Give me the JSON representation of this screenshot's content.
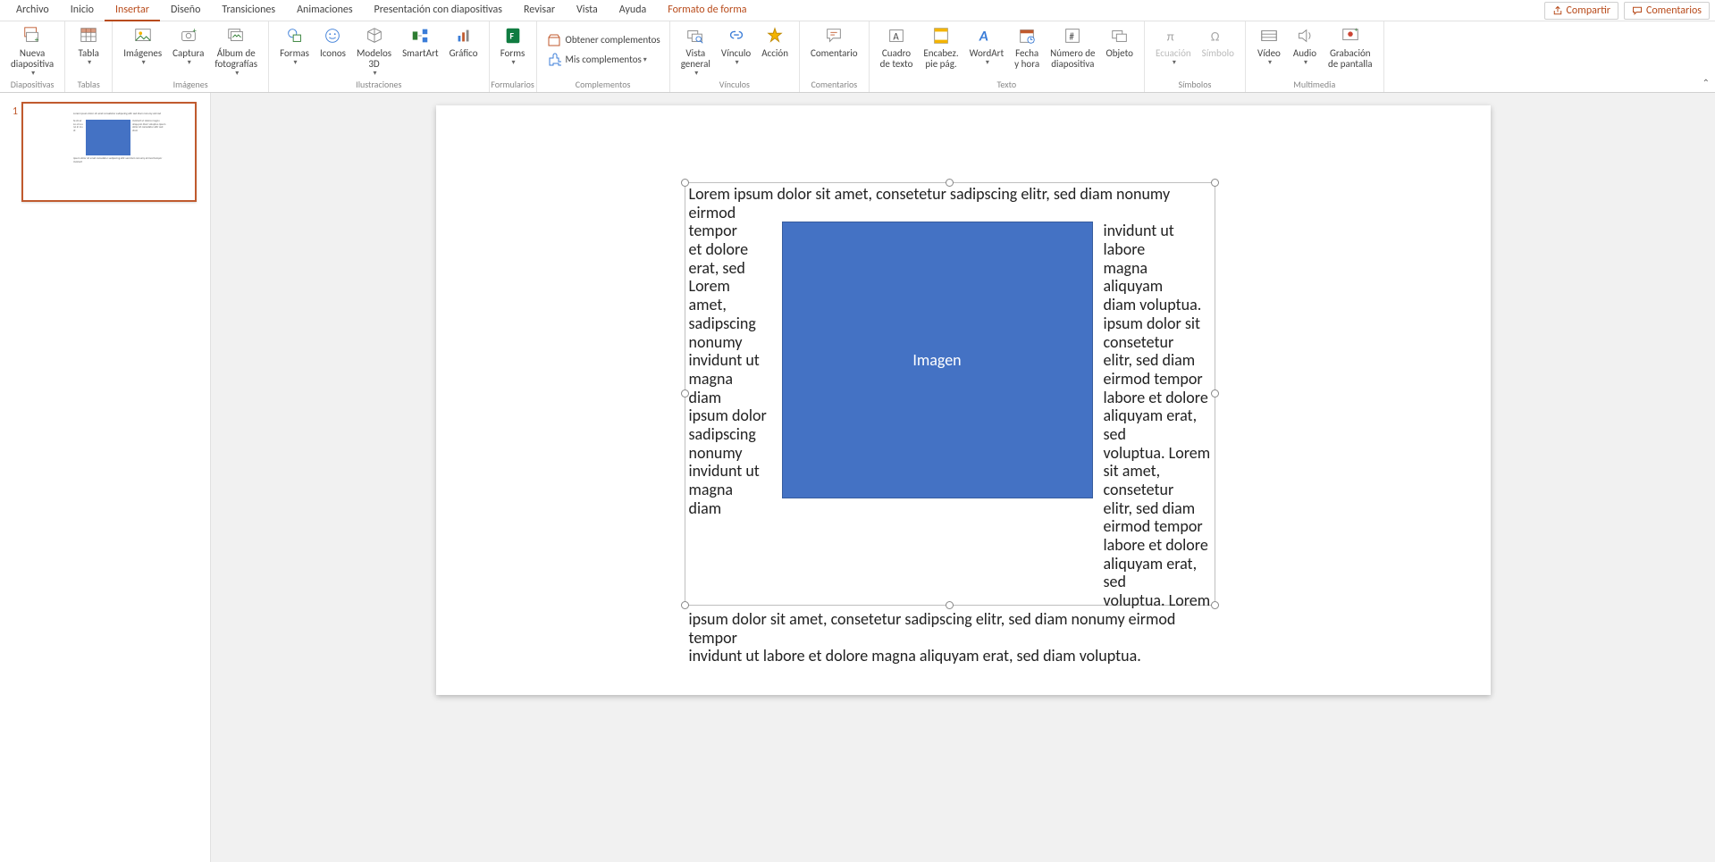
{
  "menu": {
    "tabs": [
      "Archivo",
      "Inicio",
      "Insertar",
      "Diseño",
      "Transiciones",
      "Animaciones",
      "Presentación con diapositivas",
      "Revisar",
      "Vista",
      "Ayuda"
    ],
    "active_index": 2,
    "format_tab": "Formato de forma",
    "share": "Compartir",
    "comments": "Comentarios"
  },
  "ribbon": {
    "groups": {
      "diapositivas": {
        "label": "Diapositivas",
        "new_slide": "Nueva\ndiapositiva"
      },
      "tablas": {
        "label": "Tablas",
        "table": "Tabla"
      },
      "imagenes": {
        "label": "Imágenes",
        "pictures": "Imágenes",
        "screenshot": "Captura",
        "album": "Álbum de\nfotografías"
      },
      "ilustraciones": {
        "label": "Ilustraciones",
        "shapes": "Formas",
        "icons": "Iconos",
        "models3d": "Modelos\n3D",
        "smartart": "SmartArt",
        "chart": "Gráfico"
      },
      "formularios": {
        "label": "Formularios",
        "forms": "Forms"
      },
      "complementos": {
        "label": "Complementos",
        "get": "Obtener complementos",
        "my": "Mis complementos"
      },
      "vinculos": {
        "label": "Vínculos",
        "zoom": "Vista\ngeneral",
        "link": "Vínculo",
        "action": "Acción"
      },
      "comentarios": {
        "label": "Comentarios",
        "comment": "Comentario"
      },
      "texto": {
        "label": "Texto",
        "textbox": "Cuadro\nde texto",
        "header": "Encabez.\npie pág.",
        "wordart": "WordArt",
        "datetime": "Fecha\ny hora",
        "slidenum": "Número de\ndiapositiva",
        "object": "Objeto"
      },
      "simbolos": {
        "label": "Símbolos",
        "equation": "Ecuación",
        "symbol": "Símbolo"
      },
      "multimedia": {
        "label": "Multimedia",
        "video": "Vídeo",
        "audio": "Audio",
        "screenrec": "Grabación\nde pantalla"
      }
    }
  },
  "thumbs": {
    "slide1_number": "1"
  },
  "slide": {
    "image_label": "Imagen",
    "text_before": "Lorem ipsum dolor sit amet, consetetur sadipscing elitr, sed diam nonumy eirmod",
    "text_left": "tempor\net dolore\nerat, sed\nLorem\namet,\nsadipscing\nnonumy\ninvidunt ut\nmagna\ndiam\nipsum dolor\nsadipscing\nnonumy\ninvidunt ut\nmagna\ndiam",
    "text_right": "invidunt ut labore\nmagna aliquyam\ndiam voluptua.\nipsum dolor sit\nconsetetur\nelitr, sed diam\neirmod tempor\nlabore et dolore\naliquyam erat, sed\nvoluptua. Lorem\nsit amet, consetetur\nelitr, sed diam\neirmod tempor\nlabore et dolore\naliquyam erat, sed\nvoluptua. Lorem",
    "text_after": "ipsum dolor sit amet, consetetur sadipscing elitr, sed diam nonumy eirmod tempor\ninvidunt ut labore et dolore magna aliquyam erat, sed diam voluptua."
  }
}
